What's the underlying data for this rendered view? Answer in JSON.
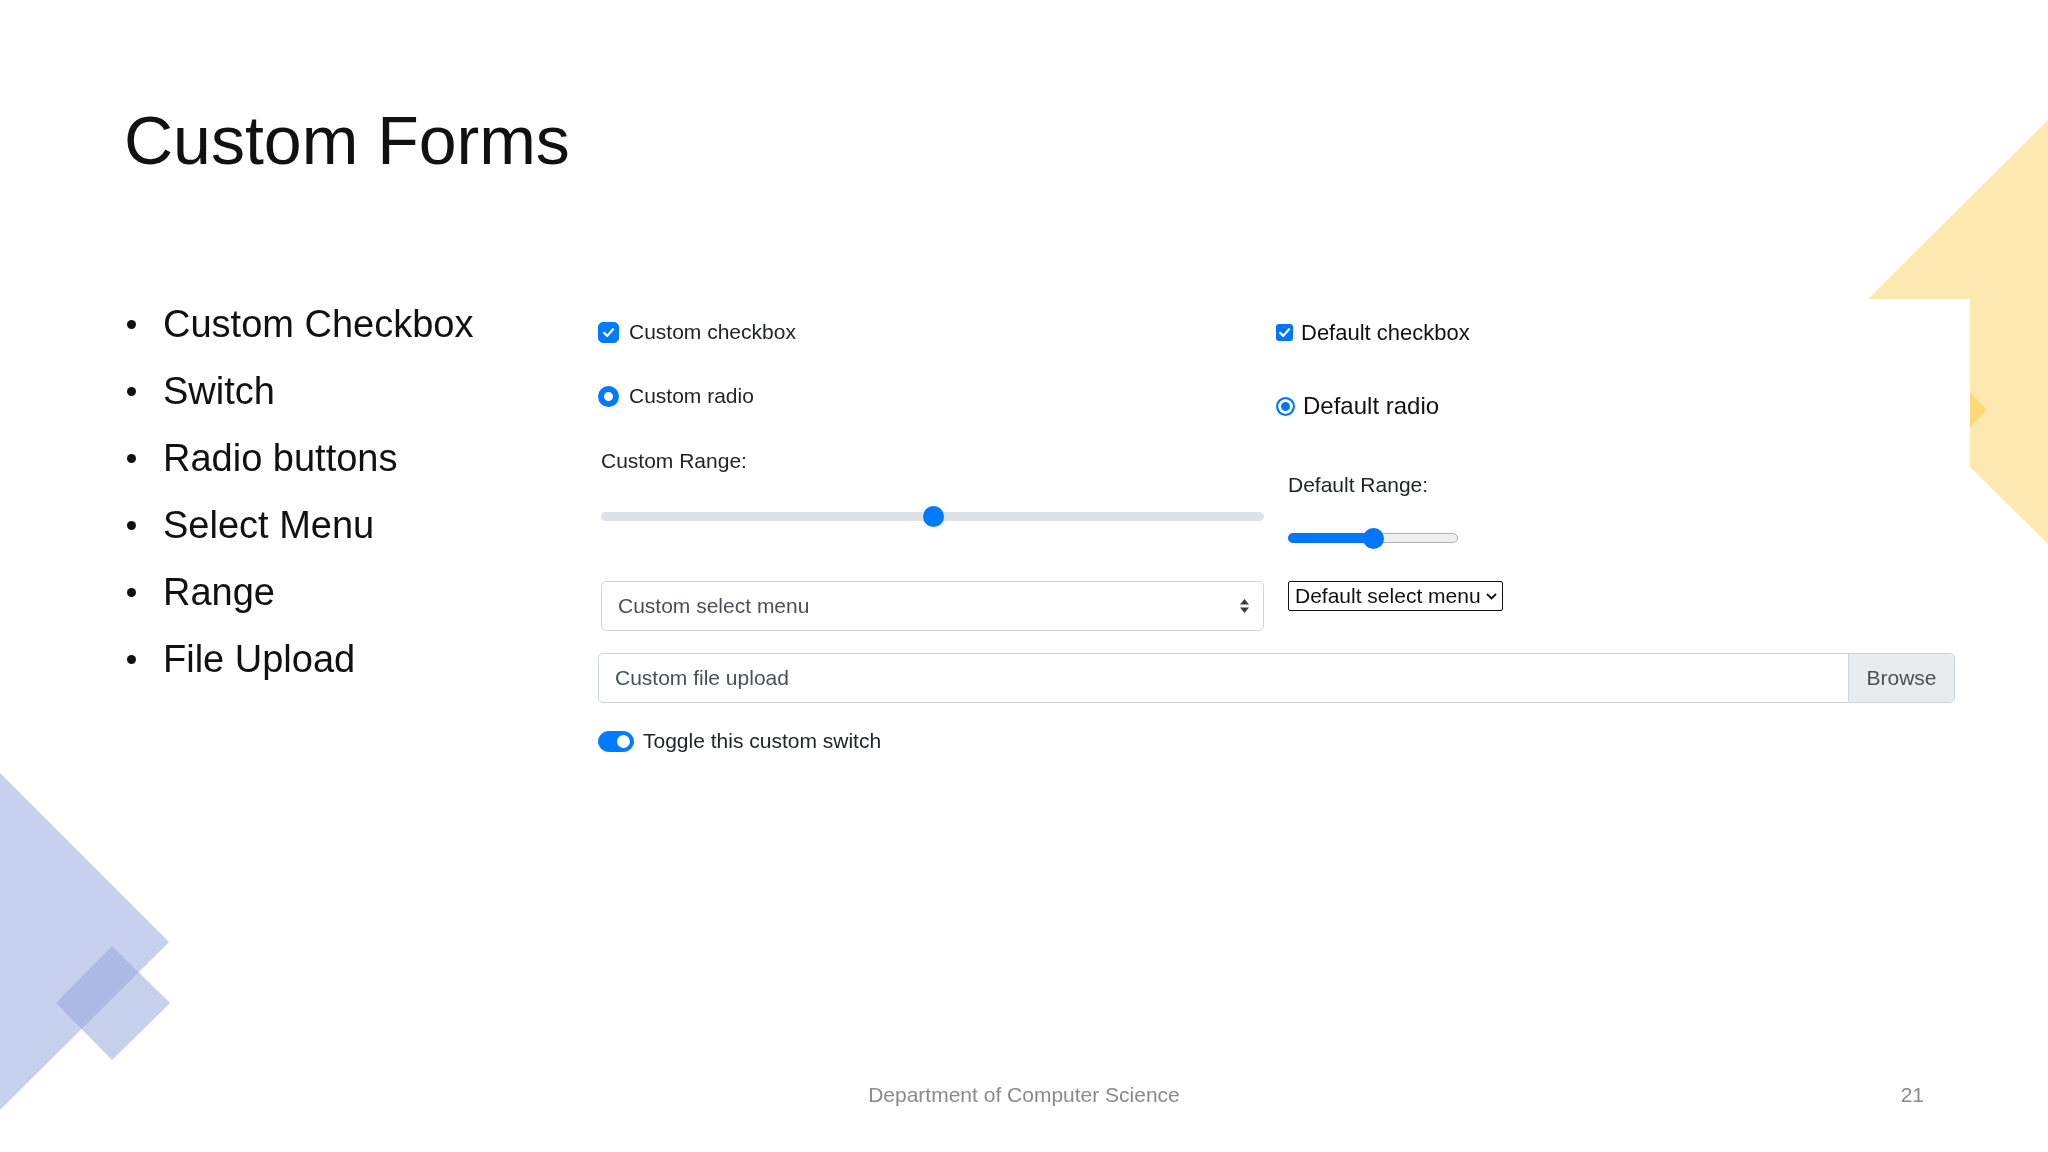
{
  "slide": {
    "title": "Custom Forms",
    "bullets": [
      "Custom Checkbox",
      "Switch",
      "Radio buttons",
      "Select Menu",
      "Range",
      "File Upload"
    ]
  },
  "demo": {
    "custom_checkbox": {
      "label": "Custom checkbox",
      "checked": true
    },
    "default_checkbox": {
      "label": "Default checkbox",
      "checked": true
    },
    "custom_radio": {
      "label": "Custom radio",
      "selected": true
    },
    "default_radio": {
      "label": "Default radio",
      "selected": true
    },
    "custom_range": {
      "label": "Custom Range:",
      "level": 0.5
    },
    "default_range": {
      "label": "Default Range:",
      "level": 0.5
    },
    "custom_select": {
      "value": "Custom select menu"
    },
    "default_select": {
      "value": "Default select menu"
    },
    "file_upload": {
      "placeholder": "Custom file upload",
      "button": "Browse"
    },
    "switch": {
      "label": "Toggle this custom switch",
      "on": true
    }
  },
  "footer": {
    "text": "Department of Computer Science",
    "page_number": "21"
  }
}
